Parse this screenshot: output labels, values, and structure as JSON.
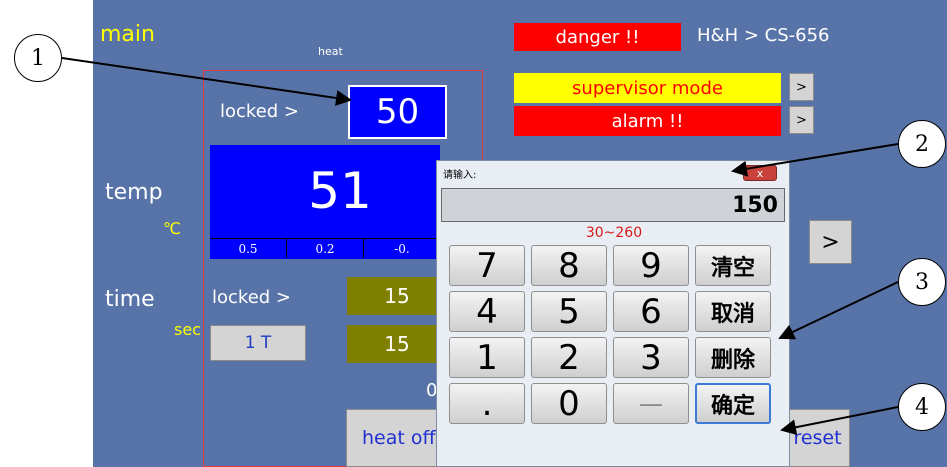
{
  "screen": {
    "title": "main",
    "heat_label": "heat",
    "danger": "danger !!",
    "breadcrumb": "H&H > CS-656",
    "supervisor": "supervisor mode",
    "alarm": "alarm !!",
    "arrow": ">",
    "temp_locked": "locked >",
    "temp_set": "50",
    "temp_label": "temp",
    "temp_unit": "℃",
    "temp_value": "51",
    "pid": [
      "0.5",
      "0.2",
      "-0."
    ],
    "time_label": "time",
    "time_unit": "sec",
    "time_locked": "locked >",
    "time_val1": "15",
    "time_val2": "15",
    "time_mode": "1 T",
    "zero": "0",
    "heat_off": "heat off",
    "reset": "reset"
  },
  "dialog": {
    "title": "请输入:",
    "close": "x",
    "value": "150",
    "range": "30~260",
    "keys": [
      "7",
      "8",
      "9",
      "清空",
      "4",
      "5",
      "6",
      "取消",
      "1",
      "2",
      "3",
      "删除",
      ".",
      "0",
      "—",
      "确定"
    ]
  },
  "callouts": [
    "1",
    "2",
    "3",
    "4"
  ],
  "colors": {
    "panel": "#5873a8",
    "accent_yellow": "#ffff00",
    "alarm_red": "#ff0000",
    "set_blue": "#0000ff",
    "olive": "#808000"
  }
}
